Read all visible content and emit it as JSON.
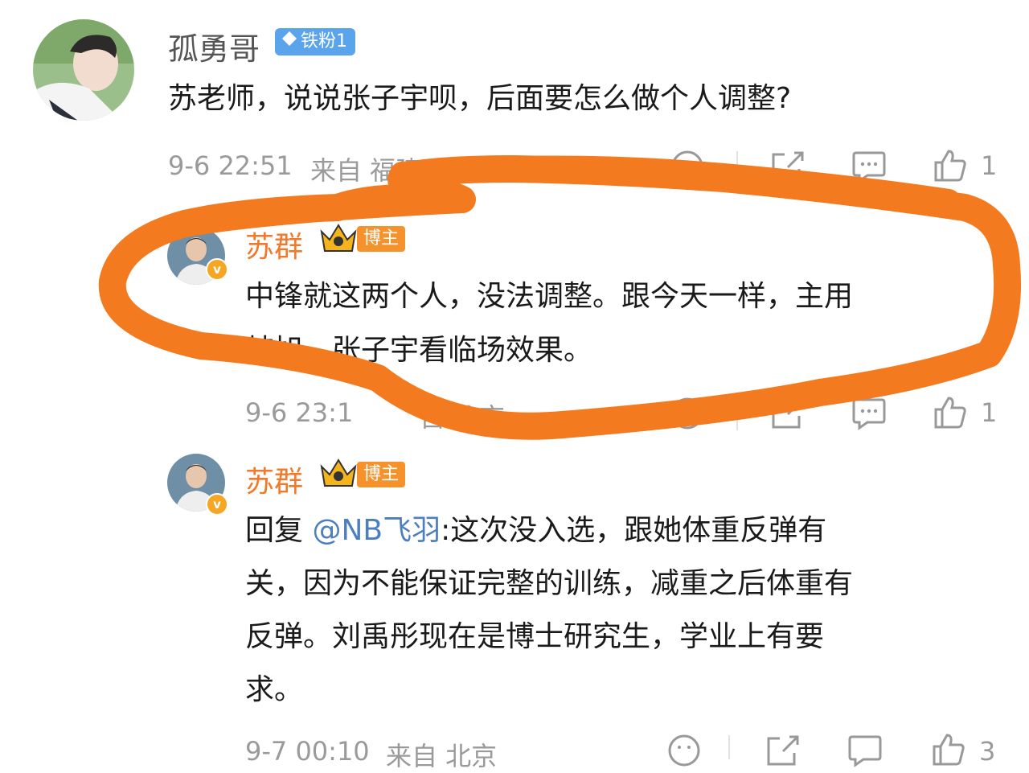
{
  "comments": [
    {
      "user": "孤勇哥",
      "badge": "铁粉1",
      "text": "苏老师，说说张子宇呗，后面要怎么做个人调整?",
      "time": "9-6 22:51",
      "location": "来自 福建",
      "likes": "1"
    },
    {
      "user": "苏群",
      "badge": "博主",
      "text_line1": "中锋就这两个人，没法调整。跟今天一样，主用",
      "text_line2": "韩旭，张子宇看临场效果。",
      "time": "9-6 23:1",
      "location": "自 北京",
      "likes": "1"
    },
    {
      "user": "苏群",
      "badge": "博主",
      "reply_prefix": "回复 ",
      "mention": "@NB飞羽",
      "line1": ":这次没入选，跟她体重反弹有",
      "line2": "关，因为不能保证完整的训练，减重之后体重有",
      "line3": "反弹。刘禹彤现在是博士研究生，学业上有要",
      "line4": "求。",
      "time": "9-7 00:10",
      "location": "来自 北京",
      "likes": "3"
    }
  ],
  "icons": {
    "share": "share-icon",
    "comment": "comment-icon",
    "like": "thumbs-up-icon",
    "emoji": "emoji-icon"
  },
  "colors": {
    "annotation": "#f47a20",
    "blogger_name": "#f07a2b",
    "mention": "#4d7fbf"
  }
}
